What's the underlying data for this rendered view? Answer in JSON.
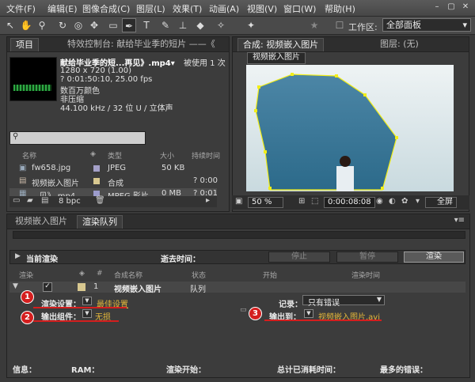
{
  "menu": [
    "文件(F)",
    "编辑(E)",
    "图像合成(C)",
    "图层(L)",
    "效果(T)",
    "动画(A)",
    "视图(V)",
    "窗口(W)",
    "帮助(H)"
  ],
  "toolbar": {
    "workspace_label": "工作区:",
    "workspace_value": "全部面板"
  },
  "project_panel": {
    "tab_project": "项目",
    "tab_effects": "特效控制台: 献给毕业季的短片 ——《",
    "file_name": "献给毕业季的短...再见》.mp4▾",
    "used_count": "被使用 1 次",
    "resolution": "1280 x 720 (1.00)",
    "duration": "? 0:01:50:10, 25.00 fps",
    "color": "数百万颜色",
    "compression": "非压缩",
    "audio": "44.100 kHz / 32 位 U / 立体声",
    "columns": {
      "name": "名称",
      "type": "类型",
      "size": "大小",
      "duration": "持续时间"
    },
    "files": [
      {
        "name": "fw658.jpg",
        "type": "JPEG",
        "size": "50 KB",
        "duration": "",
        "swatch": "#a4a0c8"
      },
      {
        "name": "视频嵌入图片",
        "type": "合成",
        "size": "",
        "duration": "? 0:00",
        "swatch": "#d8c890"
      },
      {
        "name": "...见》.mp4",
        "type": "MPEG 影片",
        "size": "0 MB",
        "duration": "? 0:01",
        "swatch": "#9c9ccc"
      }
    ],
    "bpc": "8 bpc"
  },
  "comp_panel": {
    "tab_comp": "合成: 视频嵌入图片",
    "tab_layer": "图层: (无)",
    "comp_name": "视频嵌入图片",
    "zoom": "50 %",
    "timecode": "0:00:08:08",
    "view": "全屏"
  },
  "timeline": {
    "tab_comp": "视频嵌入图片",
    "tab_render": "渲染队列"
  },
  "render_queue": {
    "current_render": "当前渲染",
    "elapsed": "逝去时间：",
    "stop": "停止",
    "pause": "暂停",
    "render": "渲染",
    "columns": {
      "render": "渲染",
      "tag": "#",
      "comp": "合成名称",
      "status": "状态",
      "start": "开始",
      "time": "渲染时间"
    },
    "row": {
      "num": "1",
      "comp": "视频嵌入图片",
      "status": "队列"
    },
    "render_settings_label": "渲染设置：",
    "render_settings_value": "最佳设置",
    "log_label": "记录：",
    "log_value": "只有错误",
    "output_module_label": "输出组件：",
    "output_module_value": "无损",
    "output_to_label": "输出到：",
    "output_to_value": "视频嵌入图片.avi",
    "badges": [
      "1",
      "2",
      "3"
    ]
  },
  "status": {
    "info": "信息：",
    "ram": "RAM：",
    "render_start": "渲染开始：",
    "total_time": "总计已消耗时间：",
    "recent_error": "最多的错误："
  }
}
